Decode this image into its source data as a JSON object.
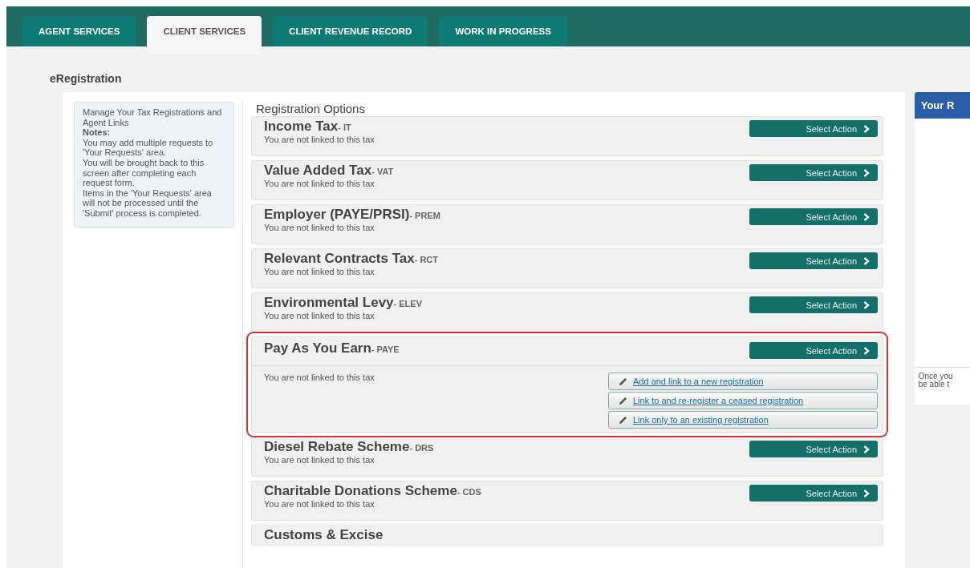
{
  "tabs": [
    {
      "label": "AGENT SERVICES",
      "selected": false
    },
    {
      "label": "CLIENT SERVICES",
      "selected": true
    },
    {
      "label": "CLIENT REVENUE RECORD",
      "selected": false
    },
    {
      "label": "WORK IN PROGRESS",
      "selected": false
    }
  ],
  "page_title": "eRegistration",
  "notes": {
    "intro": "Manage Your Tax Registrations and Agent Links",
    "heading": "Notes:",
    "lines": [
      "You may add multiple requests to 'Your Requests' area.",
      "You will be brought back to this screen after completing each request form.",
      "Items in the 'Your Requests' area will not be processed until the 'Submit' process is completed."
    ]
  },
  "registration_options": {
    "legend": "Registration Options",
    "taxes": [
      {
        "name": "Income Tax",
        "code": "- IT",
        "status": "You are not linked to this tax",
        "action": "Select Action",
        "expanded": false,
        "highlighted": false
      },
      {
        "name": "Value Added Tax",
        "code": "- VAT",
        "status": "You are not linked to this tax",
        "action": "Select Action",
        "expanded": false,
        "highlighted": false
      },
      {
        "name": "Employer (PAYE/PRSI)",
        "code": "- PREM",
        "status": "You are not linked to this tax",
        "action": "Select Action",
        "expanded": false,
        "highlighted": false
      },
      {
        "name": "Relevant Contracts Tax",
        "code": "- RCT",
        "status": "You are not linked to this tax",
        "action": "Select Action",
        "expanded": false,
        "highlighted": false
      },
      {
        "name": "Environmental Levy",
        "code": "- ELEV",
        "status": "You are not linked to this tax",
        "action": "Select Action",
        "expanded": false,
        "highlighted": false
      },
      {
        "name": "Pay As You Earn",
        "code": "- PAYE",
        "status": "You are not linked to this tax",
        "action": "Select Action",
        "expanded": true,
        "highlighted": true,
        "options": [
          "Add and link to a new registration",
          "Link to and re-register a ceased registration",
          "Link only to an existing registration"
        ]
      },
      {
        "name": "Diesel Rebate Scheme",
        "code": "- DRS",
        "status": "You are not linked to this tax",
        "action": "Select Action",
        "expanded": false,
        "highlighted": false
      },
      {
        "name": "Charitable Donations Scheme",
        "code": "- CDS",
        "status": "You are not linked to this tax",
        "action": "Select Action",
        "expanded": false,
        "highlighted": false
      },
      {
        "name": "Customs & Excise",
        "expanded": false,
        "highlighted": false
      }
    ]
  },
  "requests_panel": {
    "title": "Your R",
    "text_lines": [
      "Once you",
      "be able t"
    ]
  }
}
